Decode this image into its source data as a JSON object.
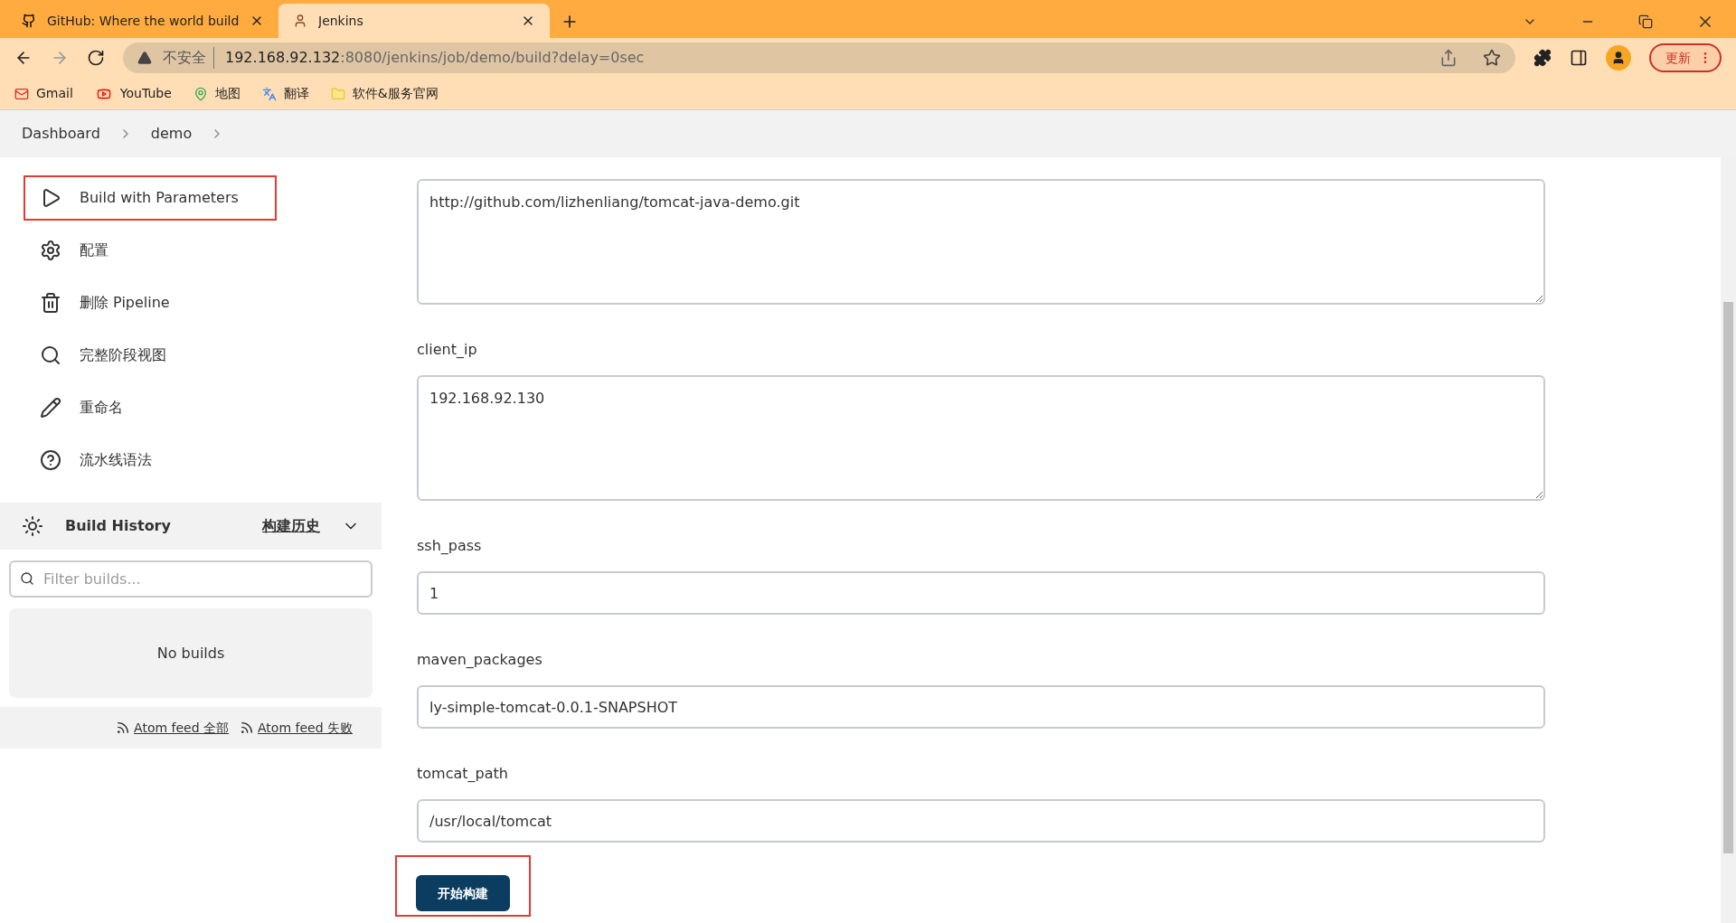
{
  "browser": {
    "tabs": [
      {
        "title": "GitHub: Where the world build",
        "selected": false
      },
      {
        "title": "Jenkins",
        "selected": true
      }
    ],
    "security": "不安全",
    "url_host": "192.168.92.132",
    "url_rest": ":8080/jenkins/job/demo/build?delay=0sec",
    "update_button": "更新",
    "bookmarks": [
      "Gmail",
      "YouTube",
      "地图",
      "翻译",
      "软件&服务官网"
    ]
  },
  "breadcrumbs": [
    "Dashboard",
    "demo"
  ],
  "sidebar": {
    "items": [
      {
        "label": "Build with Parameters",
        "highlighted": true
      },
      {
        "label": "配置",
        "highlighted": false
      },
      {
        "label": "删除 Pipeline",
        "highlighted": false
      },
      {
        "label": "完整阶段视图",
        "highlighted": false
      },
      {
        "label": "重命名",
        "highlighted": false
      },
      {
        "label": "流水线语法",
        "highlighted": false
      }
    ],
    "build_history": {
      "title": "Build History",
      "link": "构建历史",
      "filter_placeholder": "Filter builds...",
      "empty": "No builds",
      "feeds": [
        "Atom feed 全部",
        "Atom feed 失败"
      ]
    }
  },
  "parameters": [
    {
      "kind": "textarea",
      "value": "http://github.com/lizhenliang/tomcat-java-demo.git"
    },
    {
      "kind": "textarea",
      "label": "client_ip",
      "value": "192.168.92.130"
    },
    {
      "kind": "input",
      "label": "ssh_pass",
      "value": "1"
    },
    {
      "kind": "input",
      "label": "maven_packages",
      "value": "ly-simple-tomcat-0.0.1-SNAPSHOT"
    },
    {
      "kind": "input",
      "label": "tomcat_path",
      "value": "/usr/local/tomcat"
    }
  ],
  "build_button": {
    "label": "开始构建",
    "highlighted": true
  }
}
